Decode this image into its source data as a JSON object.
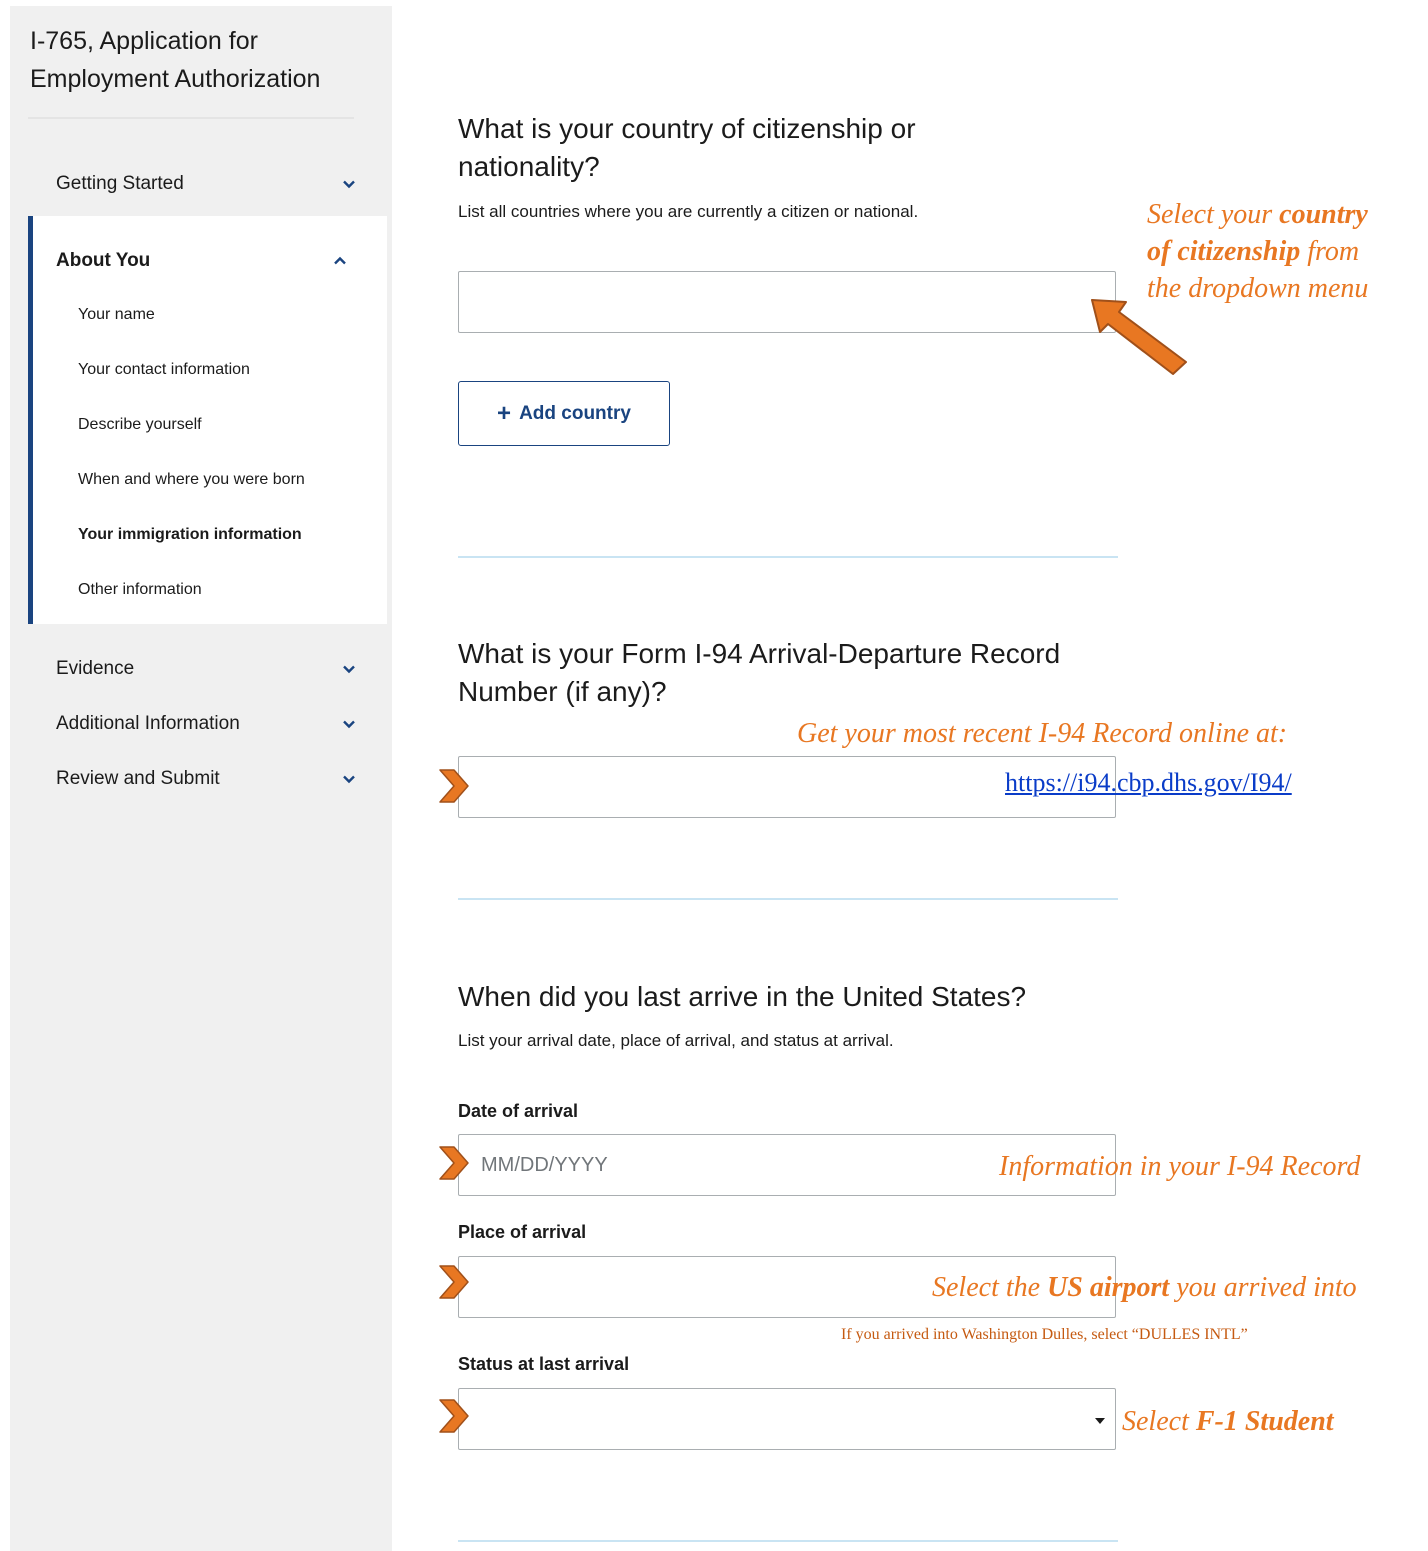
{
  "sidebar": {
    "app_title": "I-765, Application for Employment Authorization",
    "sections": {
      "getting_started": "Getting Started",
      "about_you": "About You",
      "evidence": "Evidence",
      "additional_information": "Additional Information",
      "review_and_submit": "Review and Submit"
    },
    "about_you_items": [
      "Your name",
      "Your contact information",
      "Describe yourself",
      "When and where you were born",
      "Your immigration information",
      "Other information"
    ],
    "current_item": "Your immigration information"
  },
  "citizenship": {
    "question": "What is your country of citizenship or nationality?",
    "hint": "List all countries where you are currently a citizen or national.",
    "country_value": "",
    "add_country_label": "Add country"
  },
  "i94": {
    "question": "What is your Form I-94 Arrival-Departure Record Number (if any)?",
    "value": ""
  },
  "arrival": {
    "question": "When did you last arrive in the United States?",
    "hint": "List your arrival date, place of arrival, and status at arrival.",
    "date_label": "Date of arrival",
    "date_placeholder": "MM/DD/YYYY",
    "place_label": "Place of arrival",
    "place_value": "",
    "status_label": "Status at last arrival",
    "status_value": ""
  },
  "annotations": {
    "country_note": {
      "line1_a": "Select your ",
      "line1_b": "country",
      "line2_a": "of citizenship",
      "line2_b": " from",
      "line3": "the dropdown menu"
    },
    "i94_note": "Get your most recent I-94 Record online at:",
    "i94_link": "https://i94.cbp.dhs.gov/I94/",
    "date_note": "Information in your I-94 Record",
    "place_note": {
      "a": "Select the ",
      "b": "US airport",
      "c": " you arrived into"
    },
    "place_small": "If you arrived into Washington Dulles, select “DULLES INTL”",
    "status_note": {
      "a": "Select ",
      "b": "F-1 Student"
    }
  },
  "colors": {
    "accent": "#1a4480",
    "annotation": "#e87722",
    "divider": "#c9e4f3",
    "sidebar_bg": "#f0f0f0"
  },
  "icons": {
    "chevron_down": "chevron-down-icon",
    "chevron_up": "chevron-up-icon",
    "plus": "plus-icon",
    "marker": "chevron-marker-icon",
    "arrow": "arrow-icon",
    "caret": "caret-down-icon"
  }
}
